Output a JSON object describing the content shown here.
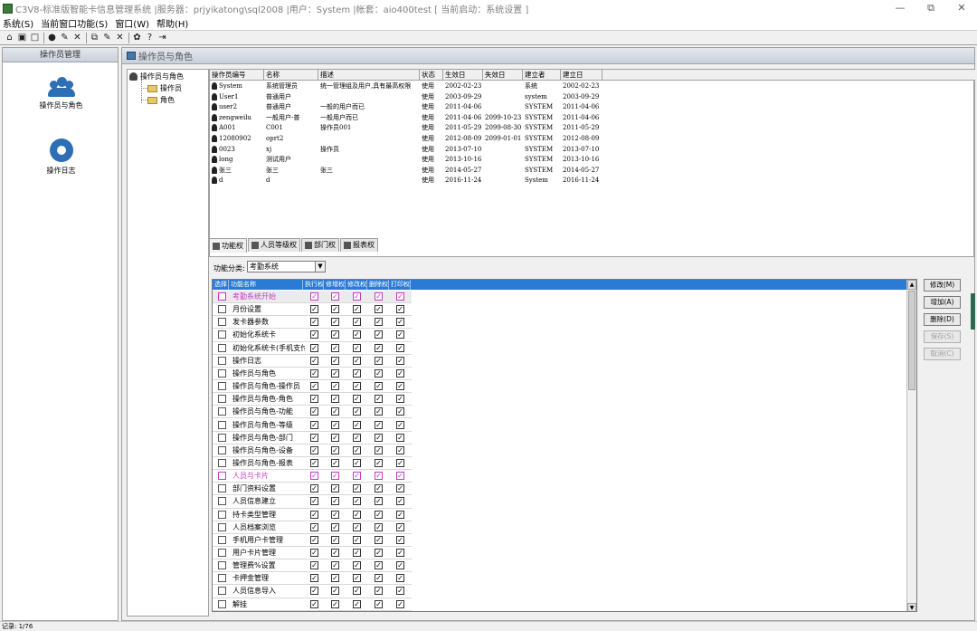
{
  "window": {
    "title": "C3V8-标准版智能卡信息管理系统 |服务器：prjyikatong\\sql2008 |用户：System |帐套：aio400test   [ 当前启动：系统设置 ]",
    "controls": [
      "—",
      "⧉",
      "✕"
    ]
  },
  "menubar": [
    "系统(S)",
    "当前窗口功能(S)",
    "窗口(W)",
    "帮助(H)"
  ],
  "left_nav": {
    "header": "操作员管理",
    "items": [
      {
        "label": "操作员与角色",
        "icon": "people-icon"
      },
      {
        "label": "操作日志",
        "icon": "gear-icon"
      }
    ]
  },
  "main": {
    "title": "操作员与角色",
    "tree": {
      "root": "操作员与角色",
      "children": [
        "操作员",
        "角色"
      ]
    },
    "operators": {
      "columns": [
        "操作员编号",
        "名称",
        "描述",
        "状态",
        "生效日",
        "失效日",
        "建立者",
        "建立日"
      ],
      "rows": [
        [
          "System",
          "系统管理员",
          "统一管理组及用户,具有最高权限",
          "使用",
          "2002-02-23",
          "",
          "系统",
          "2002-02-23"
        ],
        [
          "User1",
          "普通用户",
          "",
          "使用",
          "2003-09-29",
          "",
          "system",
          "2003-09-29"
        ],
        [
          "user2",
          "普通用户",
          "一般的用户而已",
          "使用",
          "2011-04-06",
          "",
          "SYSTEM",
          "2011-04-06"
        ],
        [
          "zengweilu",
          "一般用户-普",
          "一般用户而已",
          "使用",
          "2011-04-06",
          "2099-10-23",
          "SYSTEM",
          "2011-04-06"
        ],
        [
          "A001",
          "C001",
          "操作员001",
          "使用",
          "2011-05-29",
          "2099-08-30",
          "SYSTEM",
          "2011-05-29"
        ],
        [
          "12080902",
          "oprt2",
          "",
          "使用",
          "2012-08-09",
          "2099-01-01",
          "SYSTEM",
          "2012-08-09"
        ],
        [
          "0023",
          "xj",
          "操作员",
          "使用",
          "2013-07-10",
          "",
          "SYSTEM",
          "2013-07-10"
        ],
        [
          "long",
          "测试用户",
          "",
          "使用",
          "2013-10-16",
          "",
          "SYSTEM",
          "2013-10-16"
        ],
        [
          "张三",
          "张三",
          "张三",
          "使用",
          "2014-05-27",
          "",
          "SYSTEM",
          "2014-05-27"
        ],
        [
          "d",
          "d",
          "",
          "使用",
          "2016-11-24",
          "",
          "System",
          "2016-11-24"
        ]
      ]
    },
    "tabs": [
      "功能权",
      "人员等级权",
      "部门权",
      "报表权"
    ],
    "category_label": "功能分类:",
    "category_value": "考勤系统",
    "perm_columns": [
      "选择",
      "功能名称",
      "执行权",
      "修增权",
      "修改权",
      "删除权",
      "打印权"
    ],
    "perm_rows": [
      {
        "name": "考勤系统开始",
        "group": true
      },
      {
        "name": "月份设置"
      },
      {
        "name": "发卡器参数"
      },
      {
        "name": "初始化系统卡"
      },
      {
        "name": "初始化系统卡(手机支付)"
      },
      {
        "name": "操作日志"
      },
      {
        "name": "操作员与角色"
      },
      {
        "name": "操作员与角色-操作员"
      },
      {
        "name": "操作员与角色-角色"
      },
      {
        "name": "操作员与角色-功能"
      },
      {
        "name": "操作员与角色-等级"
      },
      {
        "name": "操作员与角色-部门"
      },
      {
        "name": "操作员与角色-设备"
      },
      {
        "name": "操作员与角色-报表"
      },
      {
        "name": "人员与卡片",
        "group": true
      },
      {
        "name": "部门资料设置"
      },
      {
        "name": "人员信息建立"
      },
      {
        "name": "持卡类型管理"
      },
      {
        "name": "人员档案浏览"
      },
      {
        "name": "手机用户卡管理"
      },
      {
        "name": "用户卡片管理"
      },
      {
        "name": "管理费%设置"
      },
      {
        "name": "卡押金管理"
      },
      {
        "name": "人员信息导入"
      },
      {
        "name": "解挂"
      }
    ],
    "check_mark": "✓",
    "scroll_up": "▲",
    "scroll_down": "▼",
    "buttons": [
      {
        "label": "修改(M)",
        "enabled": true
      },
      {
        "label": "增加(A)",
        "enabled": true
      },
      {
        "label": "删除(D)",
        "enabled": true
      },
      {
        "label": "保存(S)",
        "enabled": false
      },
      {
        "label": "取消(C)",
        "enabled": false
      }
    ]
  },
  "status": "记录: 1/76",
  "colors": {
    "grid_header": "#2b7bd6",
    "group_text": "#c03cc0",
    "nav_icon": "#2d6fb5"
  }
}
